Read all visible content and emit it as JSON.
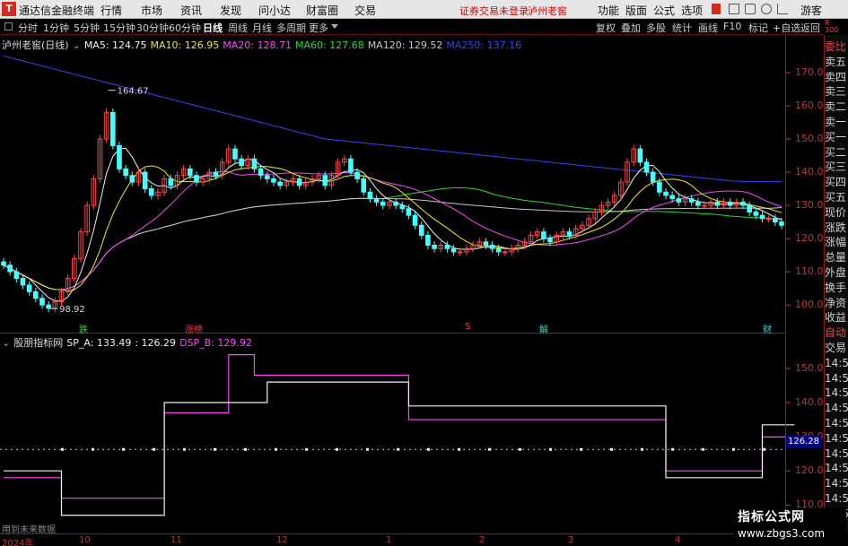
{
  "app": {
    "logo": "T",
    "title": "通达信金融终端",
    "menu": [
      "行情",
      "市场",
      "资讯",
      "发现",
      "问小达",
      "财富圈",
      "交易"
    ],
    "alert": "证券交易未登录",
    "stock_name": "泸州老窖",
    "tools": [
      "功能",
      "版面",
      "公式",
      "选项"
    ],
    "guest": "游客"
  },
  "periods": [
    "分时",
    "1分钟",
    "5分钟",
    "15分钟",
    "30分钟",
    "60分钟",
    "日线",
    "周线",
    "月线",
    "多周期",
    "更多"
  ],
  "active_period": "日线",
  "right_buttons": [
    "复权",
    "叠加",
    "多股",
    "统计",
    "画线",
    "F10",
    "标记",
    "+自选",
    "返回"
  ],
  "main_legend": {
    "name": "泸州老窖(日线)",
    "items": [
      {
        "label": "MA5: 124.75",
        "color": "#f2f2f2"
      },
      {
        "label": "MA10: 126.95",
        "color": "#f0f000"
      },
      {
        "label": "MA20: 128.71",
        "color": "#ff44ff"
      },
      {
        "label": "MA60: 127.68",
        "color": "#22dd22"
      },
      {
        "label": "MA120: 129.52",
        "color": "#c8c8c8"
      },
      {
        "label": "MA250: 137.16",
        "color": "#3344ff"
      }
    ]
  },
  "sub_legend": {
    "name": "股朋指标网",
    "items": [
      {
        "label": "SP_A: 133.49",
        "color": "#f2f2f2"
      },
      {
        "label": ": 126.29",
        "color": "#f2f2f2"
      },
      {
        "label": "DSP_B: 129.92",
        "color": "#ff44ff"
      }
    ]
  },
  "main_axis": [
    "170.0",
    "160.0",
    "150.0",
    "140.0",
    "130.0",
    "120.0",
    "110.0",
    "100.0"
  ],
  "sub_axis": [
    "150.0",
    "140.0",
    "130.0",
    "120.0",
    "110.0"
  ],
  "price_badge": "126.28",
  "high_label": "164.67",
  "low_label": "98.92",
  "events": [
    {
      "label": "跌",
      "color": "#22dd22"
    },
    {
      "label": "涨榜",
      "color": "#ff3333"
    },
    {
      "label": "S",
      "color": "#ff3333"
    },
    {
      "label": "解",
      "color": "#22dddd"
    },
    {
      "label": "财",
      "color": "#22dddd"
    }
  ],
  "dates": [
    "2024年",
    "10",
    "11",
    "12",
    "1",
    "2",
    "3",
    "4"
  ],
  "side_panel": {
    "top_labels": [
      "R",
      "300"
    ],
    "rows": [
      "委比",
      "卖五",
      "卖四",
      "卖三",
      "卖二",
      "卖一",
      "买一",
      "买二",
      "买三",
      "买四",
      "买五",
      "现价",
      "涨跌",
      "涨幅",
      "总量",
      "外盘",
      "换手",
      "净资",
      "收益",
      "自动",
      "交易",
      "14:5",
      "14:5",
      "14:5",
      "14:5",
      "14:5",
      "14:5",
      "14:5",
      "14:5",
      "14:5",
      "14:5",
      "14:5"
    ]
  },
  "used_future": "用到未来数据",
  "watermark": {
    "line1": "指标公式网",
    "line2": "www.zbgs3.com"
  },
  "chart_data": [
    {
      "type": "candlestick",
      "title": "泸州老窖(日线)",
      "ylim": [
        96,
        177
      ],
      "close": [
        112,
        110,
        108,
        106,
        104,
        102,
        100,
        99,
        101,
        104,
        108,
        114,
        122,
        130,
        138,
        150,
        158,
        148,
        141,
        139,
        137,
        140,
        135,
        133,
        134,
        138,
        136,
        139,
        141,
        139,
        137,
        138,
        140,
        139,
        143,
        147,
        144,
        142,
        144,
        141,
        139,
        138,
        137,
        136,
        137,
        138,
        136,
        137,
        138,
        139,
        136,
        139,
        143,
        144,
        140,
        138,
        134,
        132,
        131,
        130,
        131,
        130,
        129,
        127,
        124,
        121,
        118,
        117,
        118,
        117,
        116,
        116,
        117,
        118,
        119,
        118,
        117,
        116,
        116,
        117,
        118,
        119,
        121,
        122,
        120,
        119,
        121,
        122,
        121,
        123,
        124,
        126,
        128,
        130,
        131,
        133,
        137,
        143,
        147,
        143,
        140,
        137,
        134,
        133,
        132,
        131,
        132,
        131,
        130,
        130,
        131,
        130,
        131,
        130,
        131,
        130,
        128,
        127,
        126,
        126,
        125,
        124
      ],
      "ma250": [
        175,
        174.5,
        174,
        173.5,
        173,
        172.5,
        172,
        171.5,
        171,
        170.5,
        170,
        169.5,
        169,
        168.5,
        168,
        167.5,
        167,
        166.5,
        166,
        165.5,
        165,
        164.5,
        164,
        163.5,
        163,
        162.5,
        162,
        161.5,
        161,
        160.5,
        160,
        159.5,
        159,
        158.5,
        158,
        157.5,
        157,
        156.5,
        156,
        155.5,
        155,
        154.5,
        154,
        153.5,
        153,
        152.5,
        152,
        151.5,
        151,
        150.5,
        150,
        149.8,
        149.6,
        149.4,
        149.2,
        149,
        148.8,
        148.6,
        148.4,
        148.2,
        148,
        147.8,
        147.6,
        147.4,
        147.2,
        147,
        146.8,
        146.6,
        146.4,
        146.2,
        146,
        145.8,
        145.6,
        145.4,
        145.2,
        145,
        144.8,
        144.6,
        144.4,
        144.2,
        144,
        143.8,
        143.6,
        143.4,
        143.2,
        143,
        142.8,
        142.6,
        142.4,
        142.2,
        142,
        141.8,
        141.6,
        141.4,
        141.2,
        141,
        140.8,
        140.6,
        140.4,
        140.2,
        140,
        139.8,
        139.6,
        139.4,
        139.2,
        139,
        138.8,
        138.6,
        138.4,
        138.2,
        138,
        137.8,
        137.6,
        137.4,
        137.3,
        137.2,
        137.16,
        137.16,
        137.16,
        137.16,
        137.16,
        137.16
      ]
    },
    {
      "type": "line",
      "title": "股朋指标网",
      "ylim": [
        103,
        156
      ],
      "series": [
        {
          "name": "SP_A",
          "values": [
            120,
            120,
            120,
            120,
            120,
            120,
            120,
            120,
            120,
            107,
            107,
            107,
            107,
            107,
            107,
            107,
            107,
            107,
            107,
            107,
            107,
            107,
            107,
            107,
            107,
            140,
            140,
            140,
            140,
            140,
            140,
            140,
            140,
            140,
            140,
            140,
            140,
            140,
            140,
            140,
            140,
            146,
            146,
            146,
            146,
            146,
            146,
            146,
            146,
            146,
            146,
            146,
            146,
            146,
            146,
            146,
            146,
            146,
            146,
            146,
            146,
            146,
            146,
            139,
            139,
            139,
            139,
            139,
            139,
            139,
            139,
            139,
            139,
            139,
            139,
            139,
            139,
            139,
            139,
            139,
            139,
            139,
            139,
            139,
            139,
            139,
            139,
            139,
            139,
            139,
            139,
            139,
            139,
            139,
            139,
            139,
            139,
            139,
            139,
            139,
            139,
            139,
            139,
            118,
            118,
            118,
            118,
            118,
            118,
            118,
            118,
            118,
            118,
            118,
            118,
            118,
            118,
            118,
            133.49,
            133.49,
            133.49,
            133.49,
            133.49,
            133.49
          ]
        },
        {
          "name": "DSP_B",
          "values": [
            118,
            118,
            118,
            118,
            118,
            118,
            118,
            118,
            118,
            112,
            112,
            112,
            112,
            112,
            112,
            112,
            112,
            112,
            112,
            112,
            112,
            112,
            112,
            112,
            112,
            137,
            137,
            137,
            137,
            137,
            137,
            137,
            137,
            137,
            137,
            154,
            154,
            154,
            154,
            148,
            148,
            148,
            148,
            148,
            148,
            148,
            148,
            148,
            148,
            148,
            148,
            148,
            148,
            148,
            148,
            148,
            148,
            148,
            148,
            148,
            148,
            148,
            148,
            135,
            135,
            135,
            135,
            135,
            135,
            135,
            135,
            135,
            135,
            135,
            135,
            135,
            135,
            135,
            135,
            135,
            135,
            135,
            135,
            135,
            135,
            135,
            135,
            135,
            135,
            135,
            135,
            135,
            135,
            135,
            135,
            135,
            135,
            135,
            135,
            135,
            135,
            135,
            135,
            120,
            120,
            120,
            120,
            120,
            120,
            120,
            120,
            120,
            120,
            120,
            120,
            120,
            120,
            120,
            129.92,
            129.92,
            129.92,
            129.92,
            129.92,
            129.92
          ]
        }
      ],
      "reference_line": 126.28
    }
  ]
}
